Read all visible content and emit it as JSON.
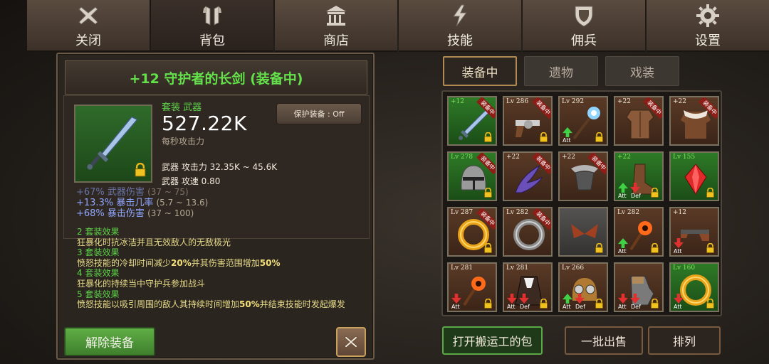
{
  "nav": {
    "tabs": [
      {
        "label": "关闭",
        "icon": "close-x-icon"
      },
      {
        "label": "背包",
        "icon": "armor-icon"
      },
      {
        "label": "商店",
        "icon": "shop-building-icon"
      },
      {
        "label": "技能",
        "icon": "lightning-icon"
      },
      {
        "label": "佣兵",
        "icon": "shield-icon"
      },
      {
        "label": "设置",
        "icon": "gear-icon"
      }
    ],
    "active_index": 1
  },
  "detail": {
    "title": "+12 守护者的长剑 (装备中)",
    "set_type": "套装 武器",
    "dps": "527.22K",
    "dps_label": "每秒攻击力",
    "protect_button": "保护装备 : Off",
    "stat_attack": "武器 攻击力 32.35K ~ 45.6K",
    "stat_speed": "武器 攻速 0.80",
    "bonus_partial": "+67% 武器伤害",
    "bonus_partial_range": "(37 ~ 75)",
    "bonus_crit_rate": "+13.3% 暴击几率",
    "bonus_crit_rate_range": "(5.7 ~ 13.6)",
    "bonus_crit_dmg": "+68% 暴击伤害",
    "bonus_crit_dmg_range": "(37 ~ 100)",
    "sets": [
      {
        "head": "2 套装效果",
        "text": "狂暴化时抗冰洁并且无效敌人的无敌极光"
      },
      {
        "head": "3 套装效果",
        "text_pre": "愤怒技能的冷却时间减少",
        "highlight": "20%",
        "text_mid": "并其伤害范围增加",
        "highlight2": "50%"
      },
      {
        "head": "4 套装效果",
        "text": "狂暴化的持续当中守护兵参加战斗"
      },
      {
        "head": "5 套装效果",
        "text_pre": "愤怒技能以吸引周围的敌人其持续时间增加",
        "highlight": "50%",
        "text_mid": "并结束技能时发起爆发"
      }
    ],
    "unequip_button": "解除装备"
  },
  "right_tabs": [
    "装备中",
    "遗物",
    "戏装"
  ],
  "grid": [
    {
      "lv": "+12",
      "eq": true,
      "lock": true,
      "bg": "green",
      "art": "sword"
    },
    {
      "lv": "Lv 286",
      "eq": true,
      "lock": true,
      "bg": "brown",
      "art": "revolver"
    },
    {
      "lv": "Lv 292",
      "eq": false,
      "lock": true,
      "bg": "brown",
      "art": "staff",
      "arrows": "up",
      "att": "Att"
    },
    {
      "lv": "+22",
      "eq": true,
      "lock": false,
      "bg": "brown",
      "art": "armor"
    },
    {
      "lv": "+22",
      "eq": true,
      "lock": false,
      "bg": "brown",
      "art": "fur-coat"
    },
    {
      "lv": "Lv 278",
      "eq": true,
      "lock": true,
      "bg": "green",
      "art": "helmet"
    },
    {
      "lv": "+22",
      "eq": true,
      "lock": false,
      "bg": "brown",
      "art": "claw"
    },
    {
      "lv": "+22",
      "eq": true,
      "lock": false,
      "bg": "brown",
      "art": "blade"
    },
    {
      "lv": "+22",
      "eq": false,
      "lock": true,
      "bg": "green",
      "art": "boots",
      "arrows": "up-down",
      "att": "Att",
      "def": "Def"
    },
    {
      "lv": "Lv 155",
      "eq": false,
      "lock": true,
      "bg": "green",
      "art": "gem"
    },
    {
      "lv": "Lv 287",
      "eq": true,
      "lock": true,
      "bg": "brown",
      "art": "ring-gold"
    },
    {
      "lv": "Lv 282",
      "eq": true,
      "lock": false,
      "bg": "brown",
      "art": "ring-silver"
    },
    {
      "lv": "",
      "eq": false,
      "lock": true,
      "bg": "grey",
      "art": "wings"
    },
    {
      "lv": "Lv 282",
      "eq": false,
      "lock": true,
      "bg": "brown",
      "art": "orb-staff",
      "arrows": "up",
      "att": "Att"
    },
    {
      "lv": "+12",
      "eq": false,
      "lock": true,
      "bg": "brown",
      "art": "rifle",
      "arrows": "down",
      "att": "Att"
    },
    {
      "lv": "Lv 281",
      "eq": false,
      "lock": true,
      "bg": "brown",
      "art": "orb-staff",
      "arrows": "down",
      "att": "Att"
    },
    {
      "lv": "Lv 281",
      "eq": false,
      "lock": true,
      "bg": "brown",
      "art": "cloak",
      "arrows": "down-down",
      "att": "Att",
      "def": "Def"
    },
    {
      "lv": "Lv 266",
      "eq": false,
      "lock": true,
      "bg": "brown",
      "art": "goggle-helm",
      "arrows": "up-down",
      "att": "Att",
      "def": "Def"
    },
    {
      "lv": "",
      "eq": false,
      "lock": true,
      "bg": "brown",
      "art": "gauntlet",
      "arrows": "down-down",
      "att": "Att",
      "def": "Def"
    },
    {
      "lv": "Lv 160",
      "eq": false,
      "lock": true,
      "bg": "green",
      "art": "ring-gold",
      "arrows": "down",
      "att": "Att"
    }
  ],
  "buttons": {
    "carrier": "打开搬运工的包",
    "bulk_sell": "一批出售",
    "sort": "排列"
  },
  "colors": {
    "set_green": "#5fd34a",
    "bonus_blue": "#8fa6ff",
    "set_text_yellow": "#e7db88",
    "title_green": "#63e04a"
  }
}
